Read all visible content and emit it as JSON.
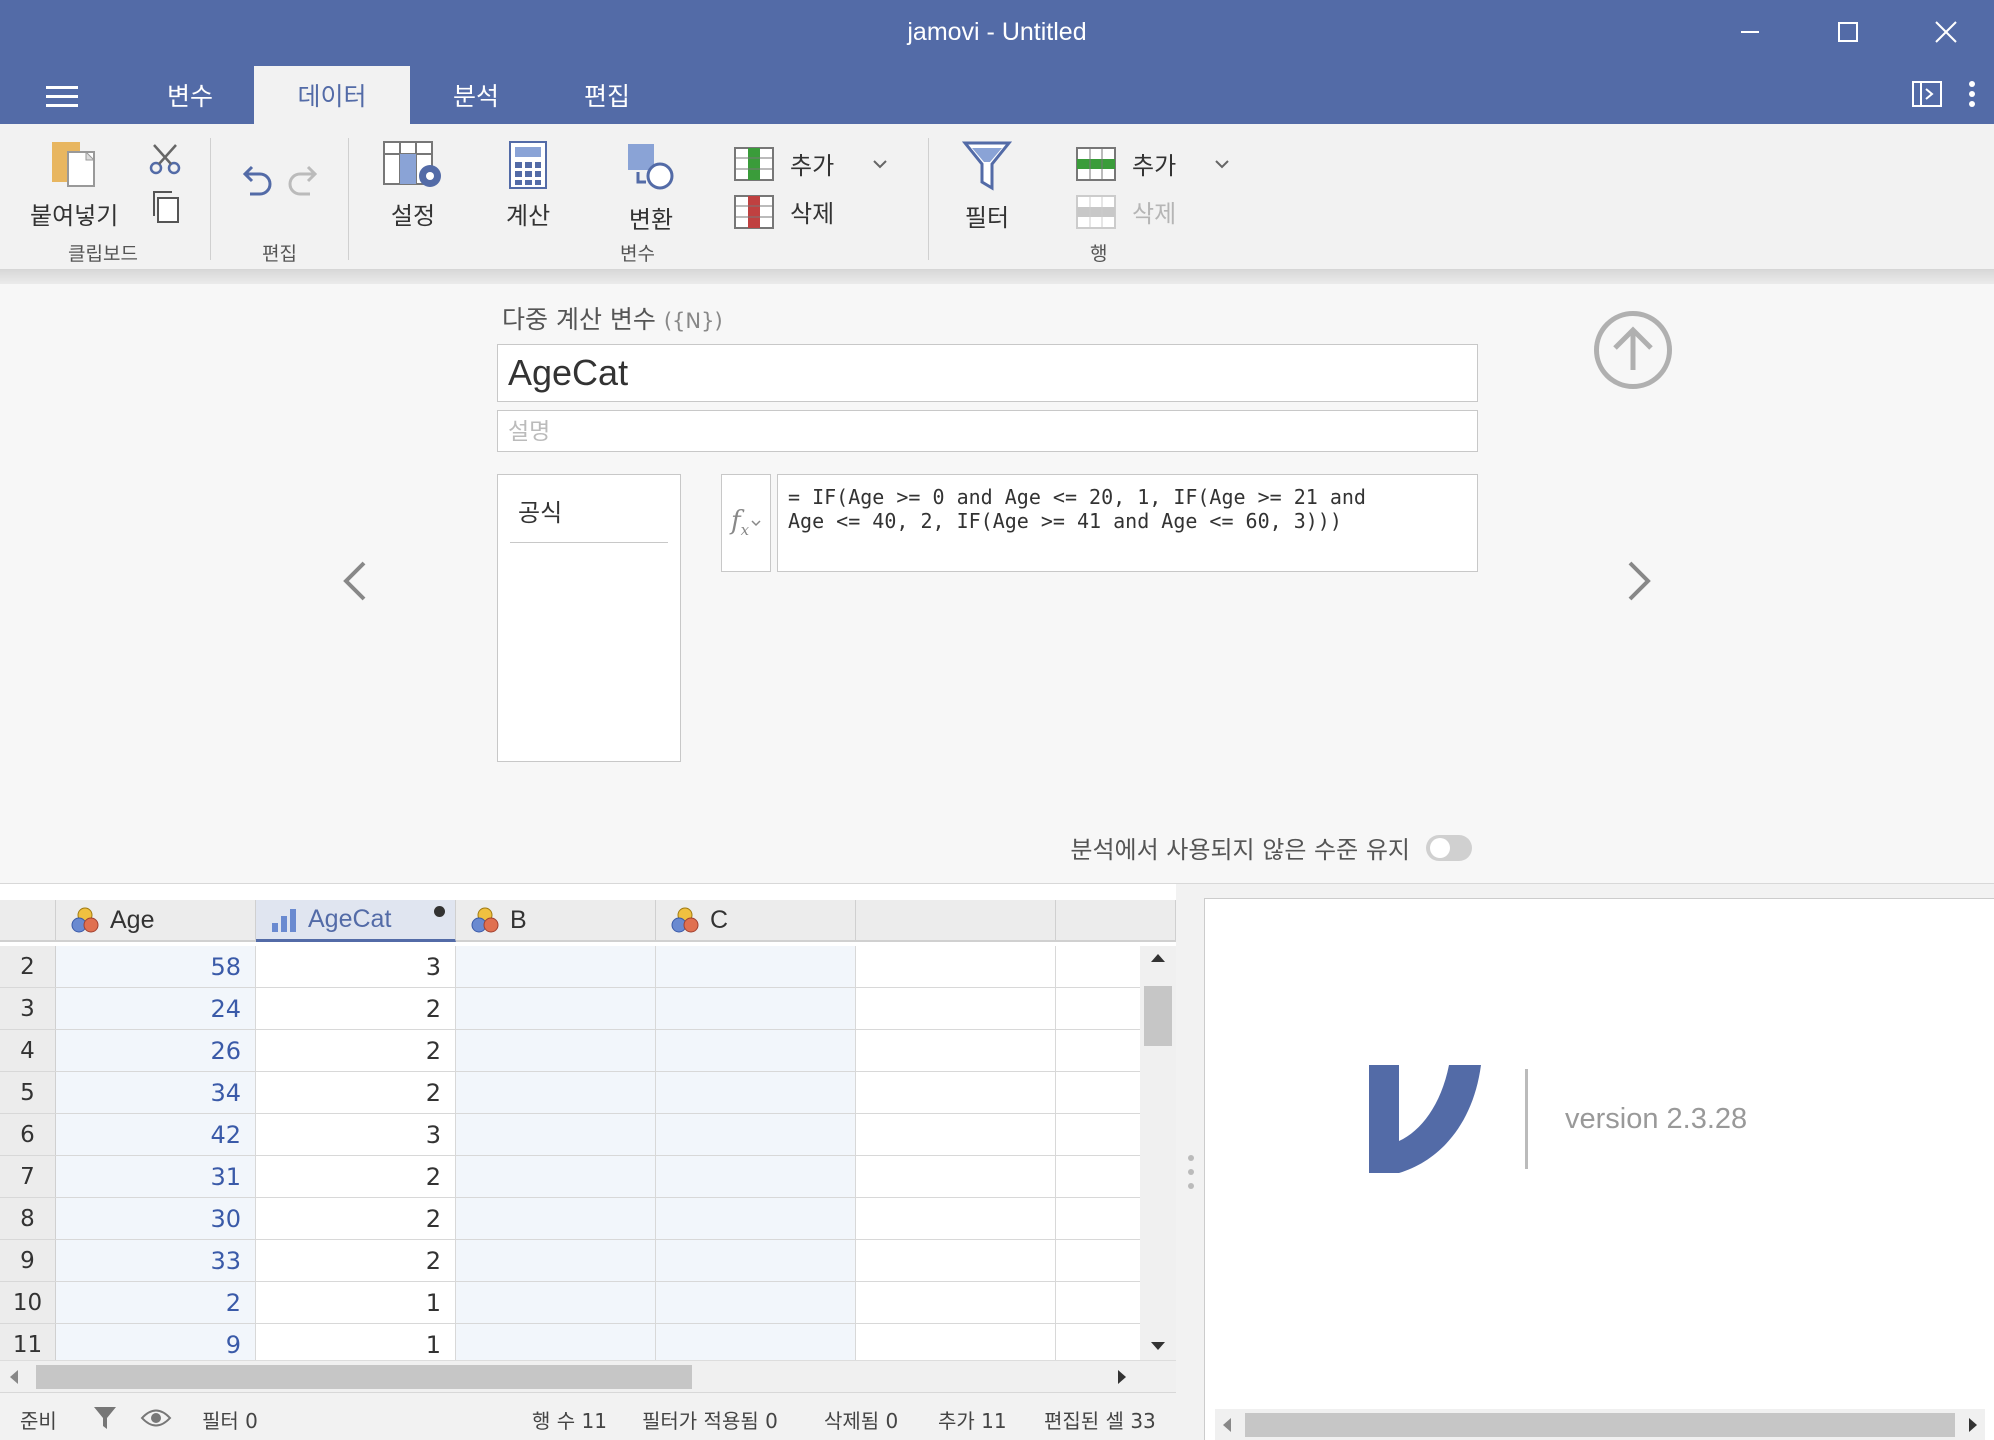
{
  "window": {
    "title": "jamovi - Untitled"
  },
  "tabs": [
    {
      "label": "변수"
    },
    {
      "label": "데이터"
    },
    {
      "label": "분석"
    },
    {
      "label": "편집"
    }
  ],
  "ribbon": {
    "paste_label": "붙여넣기",
    "clipboard_group": "클립보드",
    "edit_group": "편집",
    "setup_label": "설정",
    "compute_label": "계산",
    "transform_label": "변환",
    "variables_group": "변수",
    "var_add_label": "추가",
    "var_delete_label": "삭제",
    "filter_label": "필터",
    "row_add_label": "추가",
    "row_delete_label": "삭제",
    "rows_group": "행"
  },
  "editor": {
    "heading": "다중 계산 변수",
    "heading_sub": "({N})",
    "name_value": "AgeCat",
    "description_placeholder": "설명",
    "formula_list_item": "공식",
    "formula": "= IF(Age >= 0 and Age <= 20, 1, IF(Age >= 21 and\nAge <= 40, 2, IF(Age >= 41 and Age <= 60, 3)))",
    "retain_levels_label": "분석에서 사용되지 않은 수준 유지",
    "retain_levels_on": false
  },
  "sheet": {
    "columns": [
      "Age",
      "AgeCat",
      "B",
      "C"
    ],
    "rows": [
      {
        "n": "2",
        "age": "58",
        "agecat": "3"
      },
      {
        "n": "3",
        "age": "24",
        "agecat": "2"
      },
      {
        "n": "4",
        "age": "26",
        "agecat": "2"
      },
      {
        "n": "5",
        "age": "34",
        "agecat": "2"
      },
      {
        "n": "6",
        "age": "42",
        "agecat": "3"
      },
      {
        "n": "7",
        "age": "31",
        "agecat": "2"
      },
      {
        "n": "8",
        "age": "30",
        "agecat": "2"
      },
      {
        "n": "9",
        "age": "33",
        "agecat": "2"
      },
      {
        "n": "10",
        "age": "2",
        "agecat": "1"
      },
      {
        "n": "11",
        "age": "9",
        "agecat": "1"
      }
    ]
  },
  "results": {
    "version": "version 2.3.28"
  },
  "status": {
    "ready": "준비",
    "filter": "필터 0",
    "row_count": "행 수 11",
    "filtered": "필터가 적용됨 0",
    "deleted": "삭제됨 0",
    "added": "추가 11",
    "edited": "편집된 셀 33"
  },
  "colors": {
    "accent": "#536ba7",
    "age_text": "#3a5aa8"
  }
}
